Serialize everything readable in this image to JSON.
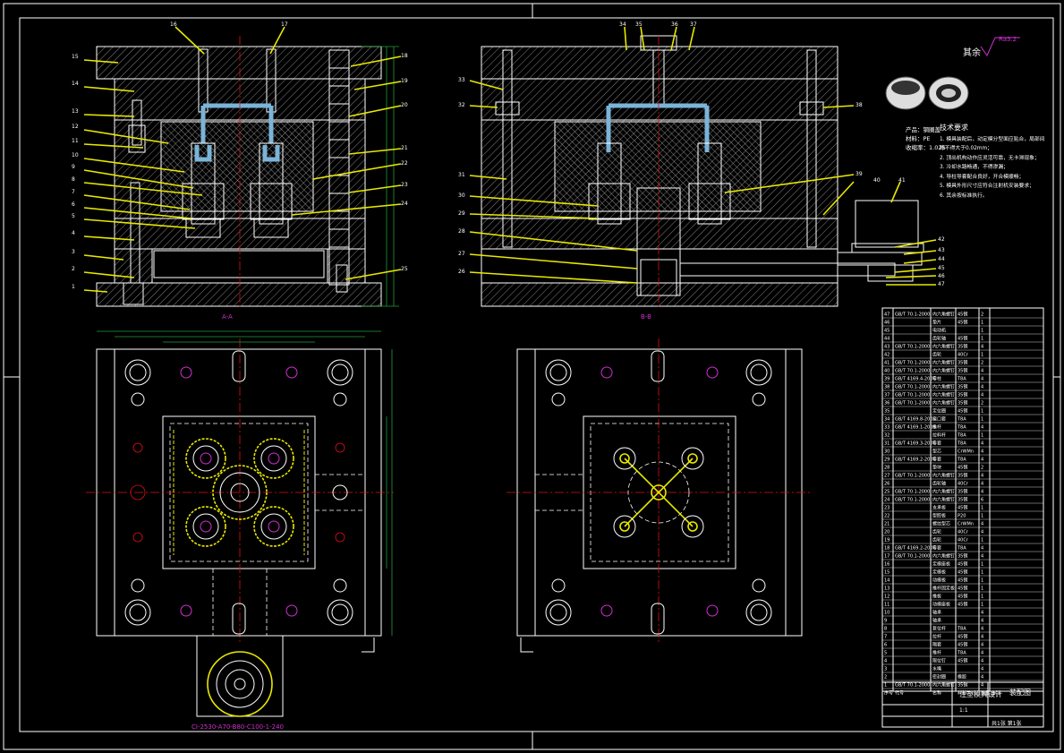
{
  "drawing": {
    "surface_finish_label": "其余",
    "surface_finish_value": "Ra3.2",
    "section_a_caption": "A-A",
    "section_b_caption": "B-B",
    "mold_base_spec": "CI-2530-A70-B80-C100-1-240",
    "product_info": {
      "line1": "产品：钢圈盖",
      "line2": "材料：PE",
      "line3": "收缩率：1.025"
    },
    "tech_requirements": {
      "title": "技术要求",
      "items": [
        "1. 模具装配后，动定模分型面应贴合，局部间隙不得大于0.02mm；",
        "2. 顶出机构动作应灵活可靠，无卡滞现象；",
        "3. 冷却水路畅通，不得渗漏；",
        "4. 导柱导套配合良好，开合模顺畅；",
        "5. 模具外形尺寸应符合注射机安装要求；",
        "6. 其余按标准执行。"
      ]
    },
    "section_a_labels": [
      "15",
      "14",
      "13",
      "12",
      "11",
      "10",
      "9",
      "8",
      "7",
      "6",
      "5",
      "4",
      "3",
      "2",
      "1"
    ],
    "section_a_right_labels": [
      "16",
      "17",
      "18",
      "19",
      "20",
      "21",
      "22",
      "23",
      "24",
      "25"
    ],
    "section_b_left_labels": [
      "33",
      "32",
      "31",
      "30",
      "29",
      "28",
      "27",
      "26"
    ],
    "section_b_right_labels": [
      "34",
      "35",
      "36",
      "37",
      "38",
      "39",
      "40",
      "41",
      "42",
      "43",
      "44",
      "45",
      "46",
      "47"
    ],
    "bom_rows": [
      [
        "47",
        "GB/T 70.1-2000",
        "内六角螺钉",
        "45钢",
        "2",
        ""
      ],
      [
        "46",
        "",
        "垫片",
        "45钢",
        "1",
        ""
      ],
      [
        "45",
        "",
        "电动机",
        "",
        "1",
        ""
      ],
      [
        "44",
        "",
        "齿轮轴",
        "45钢",
        "1",
        ""
      ],
      [
        "43",
        "GB/T 70.1-2000",
        "内六角螺钉",
        "35钢",
        "4",
        ""
      ],
      [
        "42",
        "",
        "齿轮",
        "40Cr",
        "1",
        ""
      ],
      [
        "41",
        "GB/T 70.1-2000",
        "内六角螺钉",
        "35钢",
        "2",
        ""
      ],
      [
        "40",
        "GB/T 70.1-2000",
        "内六角螺钉",
        "35钢",
        "4",
        ""
      ],
      [
        "39",
        "GB/T 4169.4-2006",
        "导柱",
        "T8A",
        "4",
        ""
      ],
      [
        "38",
        "GB/T 70.1-2000",
        "内六角螺钉",
        "35钢",
        "4",
        ""
      ],
      [
        "37",
        "GB/T 70.1-2000",
        "内六角螺钉",
        "35钢",
        "4",
        ""
      ],
      [
        "36",
        "GB/T 70.1-2000",
        "内六角螺钉",
        "35钢",
        "2",
        ""
      ],
      [
        "35",
        "",
        "定位圈",
        "45钢",
        "1",
        ""
      ],
      [
        "34",
        "GB/T 4169.8-2006",
        "浇口套",
        "T8A",
        "1",
        ""
      ],
      [
        "33",
        "GB/T 4169.1-2006",
        "推杆",
        "T8A",
        "4",
        ""
      ],
      [
        "32",
        "",
        "拉料杆",
        "T8A",
        "1",
        ""
      ],
      [
        "31",
        "GB/T 4169.3-2006",
        "导套",
        "T8A",
        "4",
        ""
      ],
      [
        "30",
        "",
        "型芯",
        "CrWMn",
        "4",
        ""
      ],
      [
        "29",
        "GB/T 4169.2-2006",
        "导套",
        "T8A",
        "4",
        ""
      ],
      [
        "28",
        "",
        "垫块",
        "45钢",
        "2",
        ""
      ],
      [
        "27",
        "GB/T 70.1-2000",
        "内六角螺钉",
        "35钢",
        "4",
        ""
      ],
      [
        "26",
        "",
        "齿轮轴",
        "40Cr",
        "4",
        ""
      ],
      [
        "25",
        "GB/T 70.1-2000",
        "内六角螺钉",
        "35钢",
        "4",
        ""
      ],
      [
        "24",
        "GB/T 70.1-2000",
        "内六角螺钉",
        "35钢",
        "6",
        ""
      ],
      [
        "23",
        "",
        "支承板",
        "45钢",
        "1",
        ""
      ],
      [
        "22",
        "",
        "型腔板",
        "P20",
        "1",
        ""
      ],
      [
        "21",
        "",
        "螺纹型芯",
        "CrWMn",
        "4",
        ""
      ],
      [
        "20",
        "",
        "齿轮",
        "40Cr",
        "4",
        ""
      ],
      [
        "19",
        "",
        "齿轮",
        "40Cr",
        "1",
        ""
      ],
      [
        "18",
        "GB/T 4169.2-2006",
        "导套",
        "T8A",
        "4",
        ""
      ],
      [
        "17",
        "GB/T 70.1-2000",
        "内六角螺钉",
        "35钢",
        "4",
        ""
      ],
      [
        "16",
        "",
        "定模座板",
        "45钢",
        "1",
        ""
      ],
      [
        "15",
        "",
        "定模板",
        "45钢",
        "1",
        ""
      ],
      [
        "14",
        "",
        "动模板",
        "45钢",
        "1",
        ""
      ],
      [
        "13",
        "",
        "推杆固定板",
        "45钢",
        "1",
        ""
      ],
      [
        "12",
        "",
        "推板",
        "45钢",
        "1",
        ""
      ],
      [
        "11",
        "",
        "动模座板",
        "45钢",
        "1",
        ""
      ],
      [
        "10",
        "",
        "轴承",
        "",
        "4",
        ""
      ],
      [
        "9",
        "",
        "轴承",
        "",
        "4",
        ""
      ],
      [
        "8",
        "",
        "复位杆",
        "T8A",
        "4",
        ""
      ],
      [
        "7",
        "",
        "拉杆",
        "45钢",
        "4",
        ""
      ],
      [
        "6",
        "",
        "隔套",
        "45钢",
        "4",
        ""
      ],
      [
        "5",
        "",
        "推杆",
        "T8A",
        "4",
        ""
      ],
      [
        "4",
        "",
        "限位钉",
        "45钢",
        "4",
        ""
      ],
      [
        "3",
        "",
        "水嘴",
        "",
        "4",
        ""
      ],
      [
        "2",
        "",
        "密封圈",
        "橡胶",
        "4",
        ""
      ],
      [
        "1",
        "GB/T 70.1-2000",
        "内六角螺钉",
        "35钢",
        "4",
        ""
      ]
    ],
    "bom_header": [
      "序号",
      "代号",
      "名称",
      "材料",
      "数量",
      "备注"
    ],
    "title_block": {
      "title": "注塑模具设计",
      "drawing_type": "装配图",
      "scale": "1:1",
      "sheet": "共1张 第1张"
    }
  }
}
